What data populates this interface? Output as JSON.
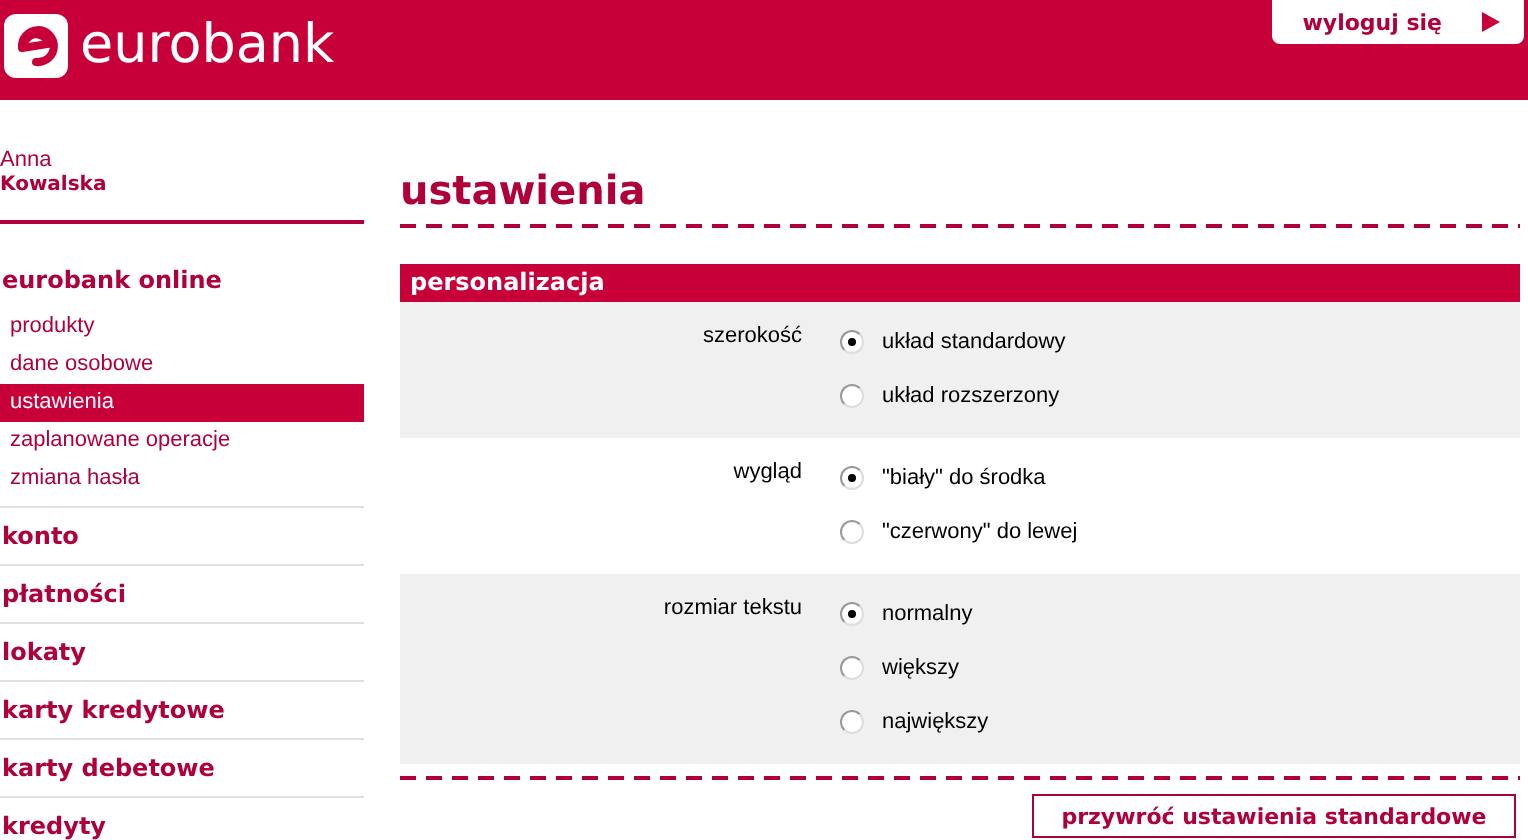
{
  "header": {
    "logo": "eurobank",
    "logout": "wyloguj się"
  },
  "user": {
    "first_name": "Anna",
    "last_name": "Kowalska"
  },
  "sidebar": {
    "sections": [
      {
        "label": "eurobank online",
        "children": [
          {
            "label": "produkty",
            "selected": false
          },
          {
            "label": "dane osobowe",
            "selected": false
          },
          {
            "label": "ustawienia",
            "selected": true
          },
          {
            "label": "zaplanowane operacje",
            "selected": false
          },
          {
            "label": "zmiana hasła",
            "selected": false
          }
        ]
      },
      {
        "label": "konto"
      },
      {
        "label": "płatności"
      },
      {
        "label": "lokaty"
      },
      {
        "label": "karty kredytowe"
      },
      {
        "label": "karty debetowe"
      },
      {
        "label": "kredyty"
      }
    ]
  },
  "page_title": "ustawienia",
  "panel": {
    "title": "personalizacja",
    "groups": [
      {
        "label": "szerokość",
        "options": [
          {
            "label": "układ standardowy",
            "selected": true
          },
          {
            "label": "układ rozszerzony",
            "selected": false
          }
        ]
      },
      {
        "label": "wygląd",
        "options": [
          {
            "label": "\"biały\" do środka",
            "selected": true
          },
          {
            "label": "\"czerwony\" do lewej",
            "selected": false
          }
        ]
      },
      {
        "label": "rozmiar tekstu",
        "options": [
          {
            "label": "normalny",
            "selected": true
          },
          {
            "label": "większy",
            "selected": false
          },
          {
            "label": "największy",
            "selected": false
          }
        ]
      }
    ]
  },
  "reset_button": "przywróć ustawienia standardowe"
}
